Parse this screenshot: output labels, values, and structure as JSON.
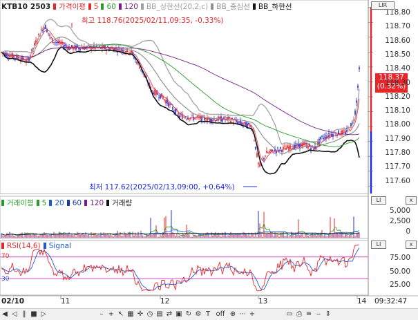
{
  "header": {
    "symbol": "KTB10",
    "contract": "2503",
    "legend": [
      {
        "label": "가격이평",
        "color": "#e8262a"
      },
      {
        "label": "5",
        "color": "#e8262a"
      },
      {
        "label": "60",
        "color": "#2a9a2a"
      },
      {
        "label": "120",
        "color": "#7a1a8a"
      },
      {
        "label": "BB_상한선(20,2,c)",
        "color": "#a0a0a0"
      },
      {
        "label": "BB_중심선",
        "color": "#909090"
      },
      {
        "label": "BB_하한선",
        "color": "#111111"
      }
    ]
  },
  "annotations": {
    "high": "최고 118.76(2025/02/11,09:35, -0.33%)",
    "low": "최저 117.62(2025/02/13,09:00, +0.64%)"
  },
  "price_tag": {
    "price": "118.37",
    "change": "(0.32%)"
  },
  "price_axis": [
    "118.80",
    "118.70",
    "118.60",
    "118.50",
    "118.40",
    "118.30",
    "118.20",
    "118.10",
    "118.00",
    "117.90",
    "117.80",
    "117.70",
    "117.60"
  ],
  "volume_panel": {
    "legend": [
      {
        "label": "거래이평",
        "color": "#2a9a2a"
      },
      {
        "label": "5",
        "color": "#2a9a2a"
      },
      {
        "label": "20",
        "color": "#1a5ad8"
      },
      {
        "label": "60",
        "color": "#1a3aa0"
      },
      {
        "label": "120",
        "color": "#7a1a8a"
      },
      {
        "label": "거래량",
        "color": "#111111"
      }
    ],
    "axis": [
      "5,000",
      "2,500",
      "0"
    ]
  },
  "rsi_panel": {
    "legend": [
      {
        "label": "RSI(14,6)",
        "color": "#e8262a"
      },
      {
        "label": "Signal",
        "color": "#1a5ad8"
      }
    ],
    "axis": [
      "75.00",
      "50.00",
      "25.00"
    ],
    "level_high": "70",
    "level_low": "30"
  },
  "x_axis": {
    "labels": [
      "02/10",
      "11",
      "12",
      "13",
      "14"
    ],
    "time": "09:32:47"
  },
  "corner_buttons": {
    "main": "LIR",
    "volume": "LI",
    "rsi": "LI"
  },
  "chart_data": {
    "type": "candlestick",
    "price_range": [
      117.55,
      118.85
    ],
    "volume_range": [
      0,
      7000
    ],
    "rsi_range": [
      0,
      100
    ],
    "x": [
      "02/10",
      "11",
      "12",
      "13",
      "14"
    ],
    "price_axis_ticks": [
      117.6,
      117.7,
      117.8,
      117.9,
      118.0,
      118.1,
      118.2,
      118.3,
      118.4,
      118.5,
      118.6,
      118.7,
      118.8
    ],
    "last_price": 118.37,
    "last_change_pct": 0.32,
    "high": 118.76,
    "low": 117.62
  }
}
